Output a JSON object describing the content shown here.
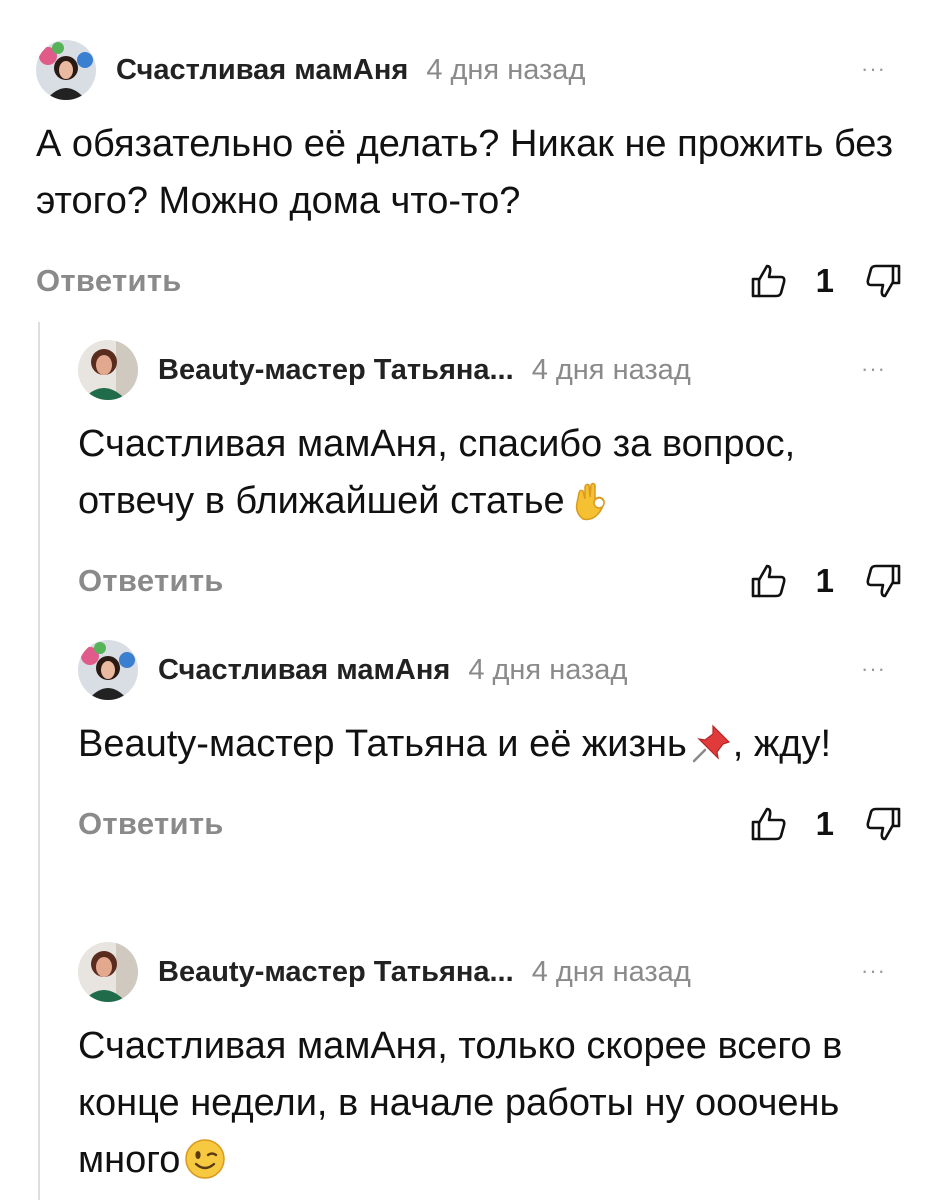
{
  "comments": [
    {
      "author": "Счастливая мамАня",
      "time": "4 дня назад",
      "more": "···",
      "text": "А обязательно её делать? Никак не прожить без этого? Можно дома что-то?",
      "reply": "Ответить",
      "likes": "1"
    },
    {
      "author": "Beauty-мастер Татьяна...",
      "time": "4 дня назад",
      "more": "···",
      "text": "Счастливая мамАня, спасибо за вопрос, отвечу в ближайшей статье",
      "emoji": "ok-hand-emoji",
      "reply": "Ответить",
      "likes": "1"
    },
    {
      "author": "Счастливая мамАня",
      "time": "4 дня назад",
      "more": "···",
      "text_before": "Beauty-мастер Татьяна и её жизнь",
      "emoji": "pushpin-emoji",
      "text_after": ", жду!",
      "reply": "Ответить",
      "likes": "1"
    },
    {
      "author": "Beauty-мастер Татьяна...",
      "time": "4 дня назад",
      "more": "···",
      "text": "Счастливая мамАня, только скорее всего в конце недели, в начале работы ну ооочень много",
      "emoji": "winking-face-emoji"
    }
  ],
  "icons": {
    "like": "thumbs-up-icon",
    "dislike": "thumbs-down-icon",
    "more": "more-dots-icon"
  },
  "colors": {
    "muted": "#8a8a8a",
    "text": "#111111",
    "thread_line": "#dedede"
  }
}
